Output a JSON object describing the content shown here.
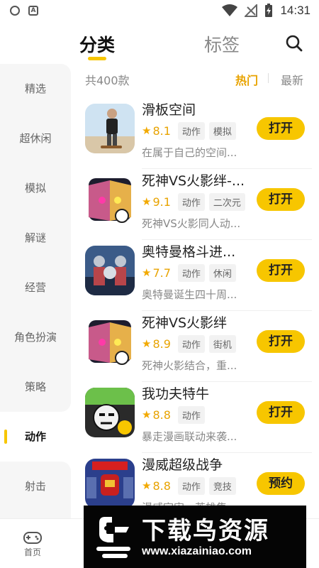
{
  "status_bar": {
    "time": "14:31",
    "app_icon_letter": "A"
  },
  "top_tabs": {
    "active": "分类",
    "inactive": "标签"
  },
  "sidebar": {
    "items": [
      {
        "label": "精选"
      },
      {
        "label": "超休闲"
      },
      {
        "label": "模拟"
      },
      {
        "label": "解谜"
      },
      {
        "label": "经营"
      },
      {
        "label": "角色扮演"
      },
      {
        "label": "策略"
      },
      {
        "label": "动作"
      },
      {
        "label": "射击"
      }
    ],
    "active_index": 7
  },
  "list_header": {
    "count": "共400款",
    "sort_hot": "热门",
    "sort_new": "最新"
  },
  "games": [
    {
      "title": "滑板空间",
      "rating": "8.1",
      "tags": [
        "动作",
        "模拟"
      ],
      "desc": "在属于自己的空间...",
      "action": "打开",
      "icon": "skateboard-icon"
    },
    {
      "title": "死神VS火影绊-...",
      "rating": "9.1",
      "tags": [
        "动作",
        "二次元"
      ],
      "desc": "死神VS火影同人动...",
      "action": "打开",
      "icon": "bleach-naruto-icon"
    },
    {
      "title": "奥特曼格斗进...",
      "rating": "7.7",
      "tags": [
        "动作",
        "休闲"
      ],
      "desc": "奥特曼诞生四十周...",
      "action": "打开",
      "icon": "ultraman-icon"
    },
    {
      "title": "死神VS火影绊",
      "rating": "8.9",
      "tags": [
        "动作",
        "街机"
      ],
      "desc": "死神火影结合，重...",
      "action": "打开",
      "icon": "bleach-naruto-icon"
    },
    {
      "title": "我功夫特牛",
      "rating": "8.8",
      "tags": [
        "动作"
      ],
      "desc": "暴走漫画联动来袭...",
      "action": "打开",
      "icon": "kungfu-comic-icon"
    },
    {
      "title": "漫威超级战争",
      "rating": "8.8",
      "tags": [
        "动作",
        "竞技"
      ],
      "desc": "漫威宇宙，英雄集...",
      "action": "预约",
      "icon": "marvel-icon"
    }
  ],
  "bottom_nav": {
    "home_label": "首页"
  },
  "watermark": {
    "title": "下载鸟资源",
    "url": "www.xiazainiao.com"
  },
  "colors": {
    "accent": "#f7c600",
    "rating": "#e8a300"
  }
}
